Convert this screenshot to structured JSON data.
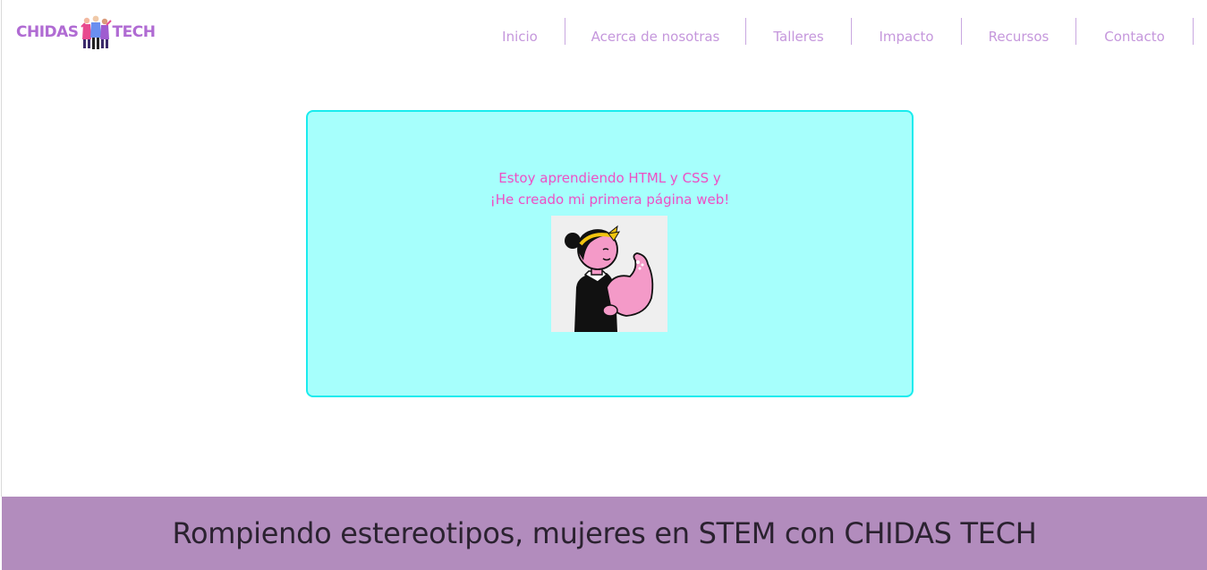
{
  "brand": {
    "left_word": "CHIDAS",
    "right_word": "TECH",
    "color": "#b06bd3"
  },
  "nav": {
    "items": [
      {
        "label": "Inicio"
      },
      {
        "label": "Acerca de nosotras"
      },
      {
        "label": "Talleres"
      },
      {
        "label": "Impacto"
      },
      {
        "label": "Recursos"
      },
      {
        "label": "Contacto"
      }
    ],
    "color": "#c597dc"
  },
  "card": {
    "line1": "Estoy aprendiendo HTML y CSS y",
    "line2": "¡He creado mi primera página web!",
    "image_icon": "flexing-woman-illustration",
    "background": "#a6fffc",
    "border": "#19ecee",
    "text_color": "#ee4fc4"
  },
  "footer": {
    "tagline": "Rompiendo estereotipos, mujeres en STEM con CHIDAS TECH",
    "background": "#b28cbd"
  }
}
